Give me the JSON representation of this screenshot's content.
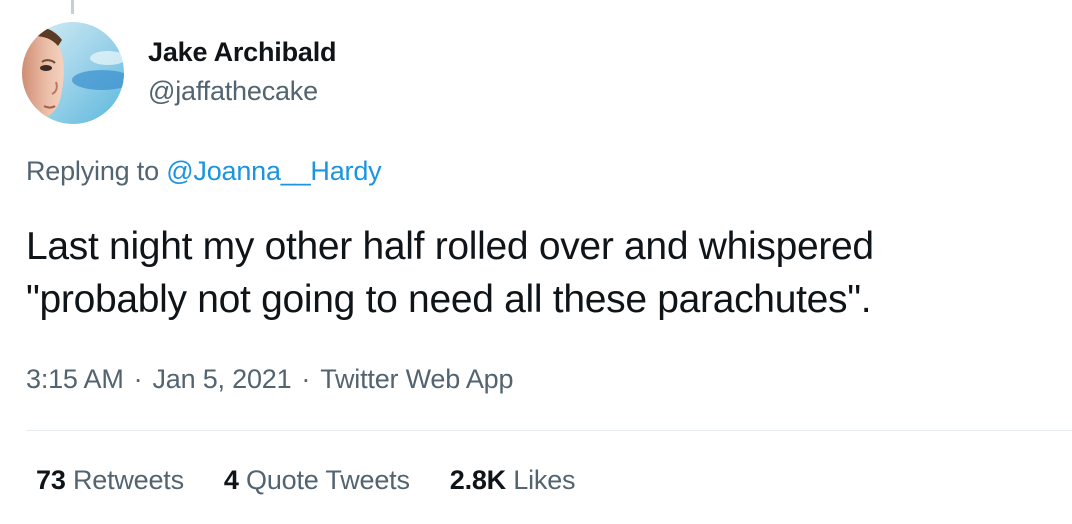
{
  "author": {
    "display_name": "Jake Archibald",
    "handle": "@jaffathecake"
  },
  "reply": {
    "prefix": "Replying to ",
    "mention": "@Joanna__Hardy"
  },
  "tweet": {
    "line1": "Last night my other half rolled over and whispered",
    "line2": "\"probably not going to need all these parachutes\"."
  },
  "meta": {
    "time": "3:15 AM",
    "separator": "·",
    "date": "Jan 5, 2021",
    "source": "Twitter Web App"
  },
  "stats": {
    "retweets_count": "73",
    "retweets_label": "Retweets",
    "quotes_count": "4",
    "quotes_label": "Quote Tweets",
    "likes_count": "2.8K",
    "likes_label": "Likes"
  },
  "colors": {
    "text_primary": "#0f1419",
    "text_secondary": "#536471",
    "link": "#1b95e0",
    "divider": "#e6ecf0"
  }
}
